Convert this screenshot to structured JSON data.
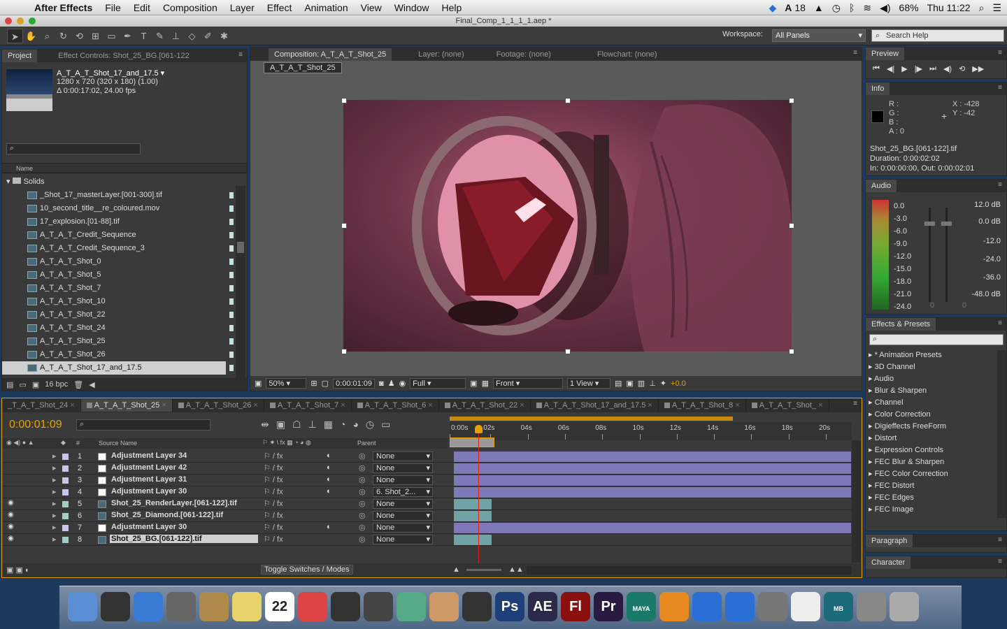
{
  "menubar": {
    "app": "After Effects",
    "items": [
      "File",
      "Edit",
      "Composition",
      "Layer",
      "Effect",
      "Animation",
      "View",
      "Window",
      "Help"
    ],
    "adobe": "18",
    "battery": "68%",
    "clock": "Thu 11:22"
  },
  "window": {
    "title": "Final_Comp_1_1_1_1.aep *"
  },
  "toolbar": {
    "workspace_label": "Workspace:",
    "workspace_value": "All Panels",
    "search_help": "Search Help"
  },
  "project": {
    "tab": "Project",
    "effect_controls_tab": "Effect Controls: Shot_25_BG.[061-122",
    "item_name": "A_T_A_T_Shot_17_and_17.5 ▾",
    "item_dims": "1280 x 720  (320 x 180) (1.00)",
    "item_duration": "Δ 0:00:17:02, 24.00 fps",
    "col_name": "Name",
    "folder": "Solids",
    "files": [
      "_Shot_17_masterLayer.[001-300].tif",
      "10_second_title__re_coloured.mov",
      "17_explosion.[01-88].tif",
      "A_T_A_T_Credit_Sequence",
      "A_T_A_T_Credit_Sequence_3",
      "A_T_A_T_Shot_0",
      "A_T_A_T_Shot_5",
      "A_T_A_T_Shot_7",
      "A_T_A_T_Shot_10",
      "A_T_A_T_Shot_22",
      "A_T_A_T_Shot_24",
      "A_T_A_T_Shot_25",
      "A_T_A_T_Shot_26",
      "A_T_A_T_Shot_17_and_17.5"
    ],
    "bpc": "16 bpc"
  },
  "comp": {
    "tab": "Composition: A_T_A_T_Shot_25",
    "layer_tab": "Layer: (none)",
    "footage_tab": "Footage: (none)",
    "flow_tab": "Flowchart: (none)",
    "crumb": "A_T_A_T_Shot_25",
    "zoom": "50%",
    "time": "0:00:01:09",
    "res": "Full",
    "view": "Front",
    "views": "1 View",
    "exposure": "+0.0"
  },
  "preview": {
    "tab": "Preview"
  },
  "info": {
    "tab": "Info",
    "r": "R :",
    "g": "G :",
    "b": "B :",
    "a": "A :  0",
    "x": "X : -428",
    "y": "Y : -42",
    "file": "Shot_25_BG.[061-122].tif",
    "duration": "Duration: 0:00:02:02",
    "inout": "In: 0:00:00:00, Out: 0:00:02:01"
  },
  "audio": {
    "tab": "Audio",
    "left": [
      "0.0",
      "-3.0",
      "-6.0",
      "-9.0",
      "-12.0",
      "-15.0",
      "-18.0",
      "-21.0",
      "-24.0"
    ],
    "right": [
      "12.0 dB",
      "0.0 dB",
      "-12.0",
      "-24.0",
      "-36.0",
      "-48.0 dB"
    ],
    "zero1": "0",
    "zero2": "0"
  },
  "effects": {
    "tab": "Effects & Presets",
    "items": [
      "* Animation Presets",
      "3D Channel",
      "Audio",
      "Blur & Sharpen",
      "Channel",
      "Color Correction",
      "Digieffects FreeForm",
      "Distort",
      "Expression Controls",
      "FEC Blur & Sharpen",
      "FEC Color Correction",
      "FEC Distort",
      "FEC Edges",
      "FEC Image"
    ]
  },
  "paragraph": {
    "tab": "Paragraph"
  },
  "character": {
    "tab": "Character"
  },
  "timeline": {
    "tabs": [
      "_T_A_T_Shot_24",
      "A_T_A_T_Shot_25",
      "A_T_A_T_Shot_26",
      "A_T_A_T_Shot_7",
      "A_T_A_T_Shot_6",
      "A_T_A_T_Shot_22",
      "A_T_A_T_Shot_17_and_17.5",
      "A_T_A_T_Shot_8",
      "A_T_A_T_Shot_"
    ],
    "time": "0:00:01:09",
    "col_hash": "#",
    "col_source": "Source Name",
    "col_parent": "Parent",
    "ruler": [
      "0:00s",
      "02s",
      "04s",
      "06s",
      "08s",
      "10s",
      "12s",
      "14s",
      "16s",
      "18s",
      "20s"
    ],
    "toggle": "Toggle Switches / Modes",
    "layers": [
      {
        "n": "1",
        "name": "Adjustment Layer 34",
        "parent": "None"
      },
      {
        "n": "2",
        "name": "Adjustment Layer 42",
        "parent": "None"
      },
      {
        "n": "3",
        "name": "Adjustment Layer 31",
        "parent": "None"
      },
      {
        "n": "4",
        "name": "Adjustment Layer 30",
        "parent": "6. Shot_2..."
      },
      {
        "n": "5",
        "name": "Shot_25_RenderLayer.[061-122].tif",
        "parent": "None"
      },
      {
        "n": "6",
        "name": "Shot_25_Diamond.[061-122].tif",
        "parent": "None"
      },
      {
        "n": "7",
        "name": "Adjustment Layer 30",
        "parent": "None"
      },
      {
        "n": "8",
        "name": "Shot_25_BG.[061-122].tif",
        "parent": "None"
      }
    ]
  },
  "dock": {
    "calendar_day": "22",
    "apps": [
      "Finder",
      "Dashboard",
      "Safari",
      "Launchpad",
      "Mail",
      "Stickies",
      "Calendar",
      "Preview",
      "Photo Booth",
      "FaceTime",
      "iPhoto",
      "GarageBand",
      "iMovie",
      "Ps",
      "AE",
      "Fl",
      "Pr",
      "MAYA",
      "iBooks",
      "iTunes",
      "App Store",
      "System Preferences",
      "TextEdit",
      "MB",
      "Downloads",
      "Trash"
    ]
  },
  "colors": {
    "panel": "#3a3a3a",
    "accent": "#e8a000",
    "bar": "#7d78b8",
    "teal": "#6fa3a6"
  }
}
